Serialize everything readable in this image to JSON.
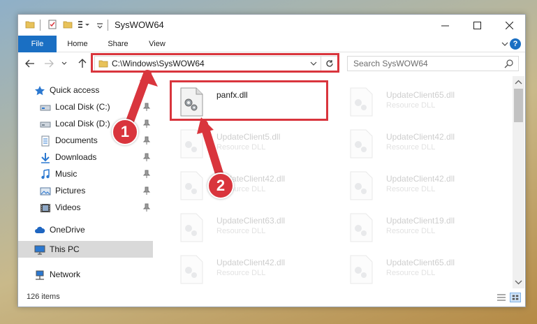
{
  "window": {
    "title": "SysWOW64"
  },
  "ribbon": {
    "tabs": [
      "File",
      "Home",
      "Share",
      "View"
    ],
    "help": "?"
  },
  "address": {
    "path": "C:\\Windows\\SysWOW64"
  },
  "search": {
    "placeholder": "Search SysWOW64"
  },
  "sidebar": {
    "items": [
      {
        "label": "Quick access",
        "icon": "star-icon"
      },
      {
        "label": "Local Disk (C:)",
        "icon": "drive-icon",
        "pinned": true
      },
      {
        "label": "Local Disk (D:)",
        "icon": "drive-icon",
        "pinned": true
      },
      {
        "label": "Documents",
        "icon": "documents-icon",
        "pinned": true
      },
      {
        "label": "Downloads",
        "icon": "download-icon",
        "pinned": true
      },
      {
        "label": "Music",
        "icon": "music-icon",
        "pinned": true
      },
      {
        "label": "Pictures",
        "icon": "pictures-icon",
        "pinned": true
      },
      {
        "label": "Videos",
        "icon": "videos-icon",
        "pinned": true
      },
      {
        "label": "OneDrive",
        "icon": "cloud-icon"
      },
      {
        "label": "This PC",
        "icon": "computer-icon",
        "selected": true
      },
      {
        "label": "Network",
        "icon": "network-icon"
      }
    ]
  },
  "files": [
    {
      "name": "panfx.dll",
      "type": "",
      "faded": false
    },
    {
      "name": "UpdateClient65.dll",
      "type": "Resource DLL",
      "faded": true
    },
    {
      "name": "UpdateClient5.dll",
      "type": "Resource DLL",
      "faded": true
    },
    {
      "name": "UpdateClient42.dll",
      "type": "Resource DLL",
      "faded": true
    },
    {
      "name": "UpdateClient42.dll",
      "type": "Resource DLL",
      "faded": true
    },
    {
      "name": "UpdateClient42.dll",
      "type": "Resource DLL",
      "faded": true
    },
    {
      "name": "UpdateClient63.dll",
      "type": "Resource DLL",
      "faded": true
    },
    {
      "name": "UpdateClient19.dll",
      "type": "Resource DLL",
      "faded": true
    },
    {
      "name": "UpdateClient42.dll",
      "type": "Resource DLL",
      "faded": true
    },
    {
      "name": "UpdateClient65.dll",
      "type": "Resource DLL",
      "faded": true
    }
  ],
  "status": {
    "item_count": "126 items"
  },
  "annotations": {
    "callout_1": "1",
    "callout_2": "2"
  },
  "colors": {
    "accent": "#1a6fc3",
    "highlight": "#d9353d",
    "selected": "#d9d9d9"
  }
}
